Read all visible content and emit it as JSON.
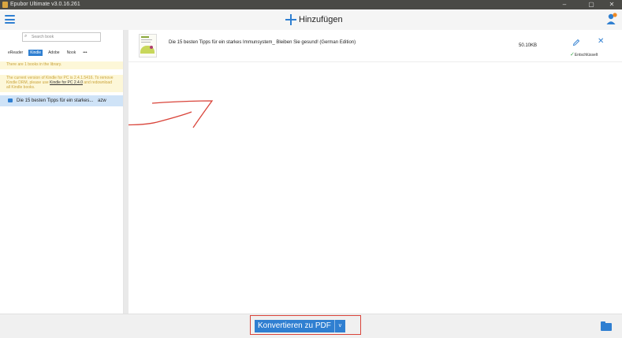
{
  "window": {
    "title": "Epubor Ultimate v3.0.16.261",
    "minimize": "–",
    "maximize": "▢",
    "close": "✕"
  },
  "header": {
    "add_label": "Hinzufügen"
  },
  "sidebar": {
    "search_placeholder": "Search book",
    "tabs": [
      {
        "label": "eReader"
      },
      {
        "label": "Kindle",
        "active": true
      },
      {
        "label": "Adobe"
      },
      {
        "label": "Nook"
      },
      {
        "label": "•••"
      }
    ],
    "notice_count": "There are 1 books in the library.",
    "notice_version_pre": "The current version of Kindle for PC is 2.4.1.5416. To remove Kindle DRM, please use ",
    "notice_version_link": "Kindle for PC 2.4.0",
    "notice_version_post": " and redownload all Kindle books.",
    "book": {
      "title": "Die 15 besten Tipps für ein starkes...",
      "format": "azw"
    }
  },
  "main": {
    "book": {
      "title": "Die 15 besten Tipps für ein starkes Immunsystem_ Bleiben Sie gesund! (German Edition)",
      "size": "50.10KB",
      "status": "Entschlüsselt"
    }
  },
  "footer": {
    "convert_label": "Konvertieren zu PDF",
    "convert_dropdown": "v"
  },
  "colors": {
    "accent": "#2f7fd1",
    "notice_bg": "#fdf7d8",
    "notice_text": "#caa43c",
    "selected_bg": "#cfe3f7",
    "annotation_red": "#d9443a",
    "success_green": "#3aa84a"
  }
}
